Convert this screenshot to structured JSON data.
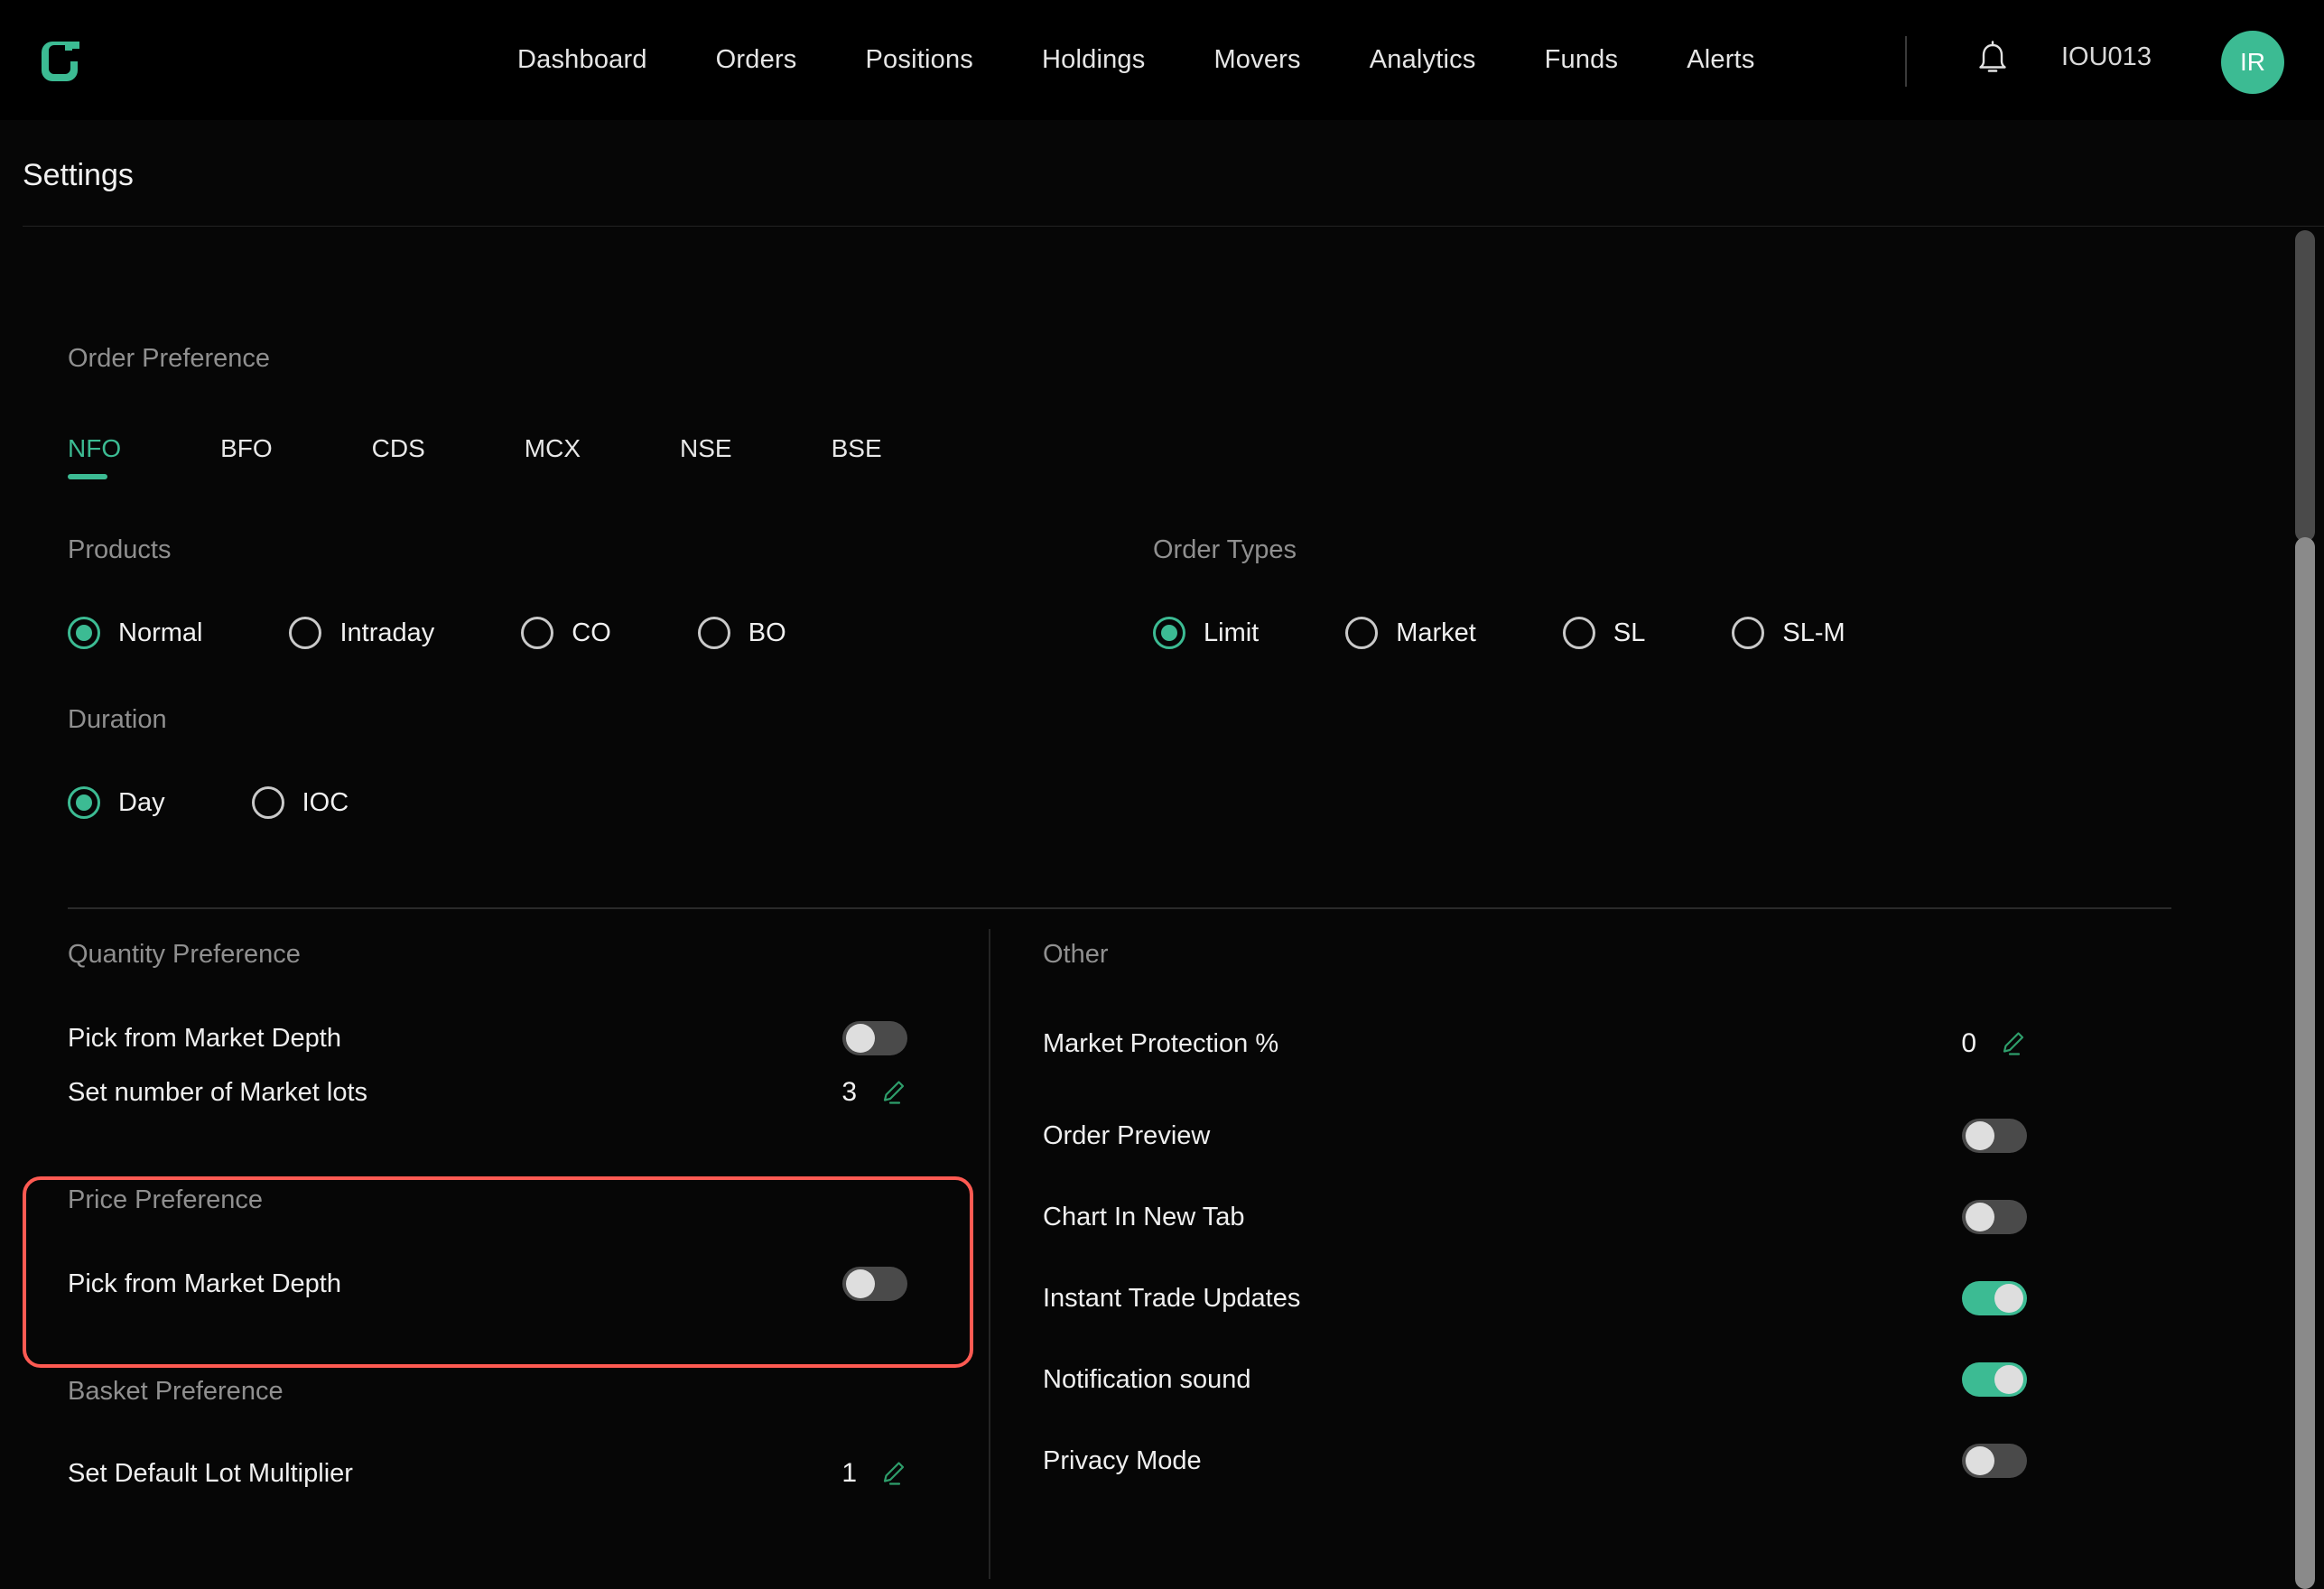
{
  "topnav": {
    "logo_name": "app-logo",
    "links": [
      {
        "label": "Dashboard"
      },
      {
        "label": "Orders"
      },
      {
        "label": "Positions"
      },
      {
        "label": "Holdings"
      },
      {
        "label": "Movers"
      },
      {
        "label": "Analytics"
      },
      {
        "label": "Funds"
      },
      {
        "label": "Alerts"
      }
    ],
    "bell_icon": "notification-bell-icon",
    "user_id": "IOU013",
    "avatar_initials": "IR"
  },
  "page": {
    "title": "Settings"
  },
  "order_preference": {
    "heading": "Order Preference",
    "exchange_tabs": [
      {
        "label": "NFO",
        "active": true
      },
      {
        "label": "BFO",
        "active": false
      },
      {
        "label": "CDS",
        "active": false
      },
      {
        "label": "MCX",
        "active": false
      },
      {
        "label": "NSE",
        "active": false
      },
      {
        "label": "BSE",
        "active": false
      }
    ],
    "products": {
      "heading": "Products",
      "options": [
        {
          "label": "Normal",
          "selected": true
        },
        {
          "label": "Intraday",
          "selected": false
        },
        {
          "label": "CO",
          "selected": false
        },
        {
          "label": "BO",
          "selected": false
        }
      ]
    },
    "order_types": {
      "heading": "Order Types",
      "options": [
        {
          "label": "Limit",
          "selected": true
        },
        {
          "label": "Market",
          "selected": false
        },
        {
          "label": "SL",
          "selected": false
        },
        {
          "label": "SL-M",
          "selected": false
        }
      ]
    },
    "duration": {
      "heading": "Duration",
      "options": [
        {
          "label": "Day",
          "selected": true
        },
        {
          "label": "IOC",
          "selected": false
        }
      ]
    }
  },
  "quantity_preference": {
    "heading": "Quantity Preference",
    "pick_from_market_depth_label": "Pick from Market Depth",
    "pick_from_market_depth_on": false,
    "set_market_lots_label": "Set number of Market lots",
    "set_market_lots_value": "3"
  },
  "price_preference": {
    "heading": "Price Preference",
    "pick_from_market_depth_label": "Pick from Market Depth",
    "pick_from_market_depth_on": false,
    "highlighted": true,
    "highlight_color": "#ff5a52"
  },
  "basket_preference": {
    "heading": "Basket Preference",
    "default_lot_multiplier_label": "Set Default Lot Multiplier",
    "default_lot_multiplier_value": "1"
  },
  "other": {
    "heading": "Other",
    "rows": [
      {
        "label": "Market Protection %",
        "type": "value",
        "value": "0"
      },
      {
        "label": "Order Preview",
        "type": "toggle",
        "on": false
      },
      {
        "label": "Chart In New Tab",
        "type": "toggle",
        "on": false
      },
      {
        "label": "Instant Trade Updates",
        "type": "toggle",
        "on": true
      },
      {
        "label": "Notification sound",
        "type": "toggle",
        "on": true
      },
      {
        "label": "Privacy Mode",
        "type": "toggle",
        "on": false
      }
    ]
  },
  "colors": {
    "accent_green": "#3cbb93",
    "background": "#060606",
    "highlight_red": "#ff5a52",
    "toggle_off": "#4a4a4a"
  },
  "icons": {
    "edit_pencil": "edit-pencil-icon"
  }
}
